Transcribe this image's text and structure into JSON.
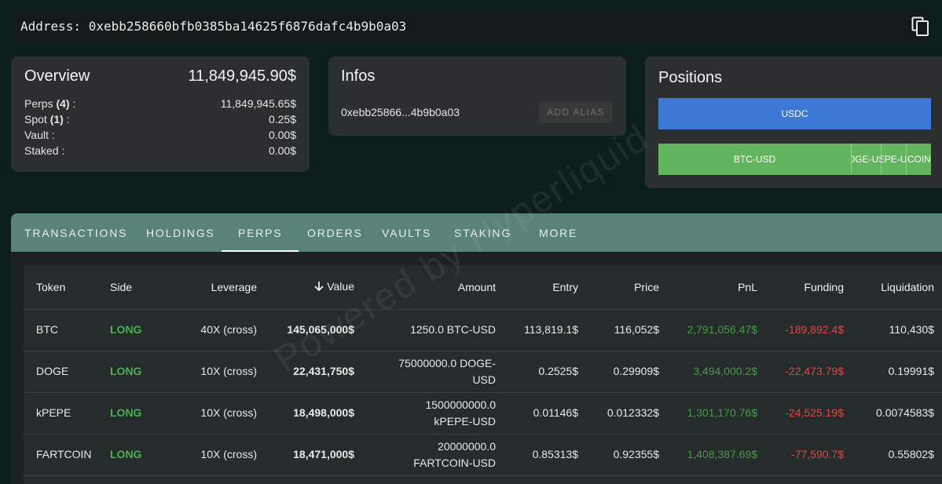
{
  "address": {
    "label": "Address:",
    "value": "0xebb258660bfb0385ba14625f6876dafc4b9b0a03"
  },
  "overview": {
    "title": "Overview",
    "total": "11,849,945.90$",
    "rows": [
      {
        "label": "Perps",
        "count": "(4)",
        "suffix": " :",
        "value": "11,849,945.65$"
      },
      {
        "label": "Spot",
        "count": "(1)",
        "suffix": " :",
        "value": "0.25$"
      },
      {
        "label": "Vault :",
        "count": "",
        "suffix": "",
        "value": "0.00$"
      },
      {
        "label": "Staked :",
        "count": "",
        "suffix": "",
        "value": "0.00$"
      }
    ]
  },
  "infos": {
    "title": "Infos",
    "short_address": "0xebb25866...4b9b0a03",
    "add_alias_label": "ADD ALIAS"
  },
  "positions": {
    "title": "Positions",
    "spot_bar": {
      "label": "USDC",
      "color": "#3e78d6",
      "fraction": 1.0
    },
    "perp_bars": [
      {
        "label": "BTC-USD",
        "fraction": 0.705
      },
      {
        "label": "DOGE-USD",
        "fraction": 0.109
      },
      {
        "label": "kPEPE-USD",
        "fraction": 0.09
      },
      {
        "label": "FARTCOIN-USD",
        "fraction": 0.09
      }
    ],
    "perp_color": "#62b55e"
  },
  "tabs": [
    {
      "label": "TRANSACTIONS",
      "active": false
    },
    {
      "label": "HOLDINGS",
      "active": false
    },
    {
      "label": "PERPS",
      "active": true
    },
    {
      "label": "ORDERS",
      "active": false
    },
    {
      "label": "VAULTS",
      "active": false
    },
    {
      "label": "STAKING",
      "active": false
    },
    {
      "label": "MORE",
      "active": false
    }
  ],
  "table": {
    "headers": {
      "token": "Token",
      "side": "Side",
      "leverage": "Leverage",
      "value": "Value",
      "amount": "Amount",
      "entry": "Entry",
      "price": "Price",
      "pnl": "PnL",
      "funding": "Funding",
      "liquidation": "Liquidation"
    },
    "sort_icon": "arrow-down-icon",
    "rows": [
      {
        "token": "BTC",
        "side": "LONG",
        "leverage": "40X (cross)",
        "value": "145,065,000$",
        "amount": "1250.0 BTC-USD",
        "entry": "113,819.1$",
        "price": "116,052$",
        "pnl": "2,791,056.47$",
        "funding": "-189,892.4$",
        "liquidation": "110,430$"
      },
      {
        "token": "DOGE",
        "side": "LONG",
        "leverage": "10X (cross)",
        "value": "22,431,750$",
        "amount": "75000000.0 DOGE-USD",
        "entry": "0.2525$",
        "price": "0.29909$",
        "pnl": "3,494,000.2$",
        "funding": "-22,473.79$",
        "liquidation": "0.19991$"
      },
      {
        "token": "kPEPE",
        "side": "LONG",
        "leverage": "10X (cross)",
        "value": "18,498,000$",
        "amount": "1500000000.0 kPEPE-USD",
        "entry": "0.01146$",
        "price": "0.012332$",
        "pnl": "1,301,170.76$",
        "funding": "-24,525.19$",
        "liquidation": "0.0074583$"
      },
      {
        "token": "FARTCOIN",
        "side": "LONG",
        "leverage": "10X (cross)",
        "value": "18,471,000$",
        "amount": "20000000.0 FARTCOIN-USD",
        "entry": "0.85313$",
        "price": "0.92355$",
        "pnl": "1,408,387.69$",
        "funding": "-77,590.7$",
        "liquidation": "0.55802$"
      }
    ]
  },
  "watermark": "Powered by Hyperliquid"
}
